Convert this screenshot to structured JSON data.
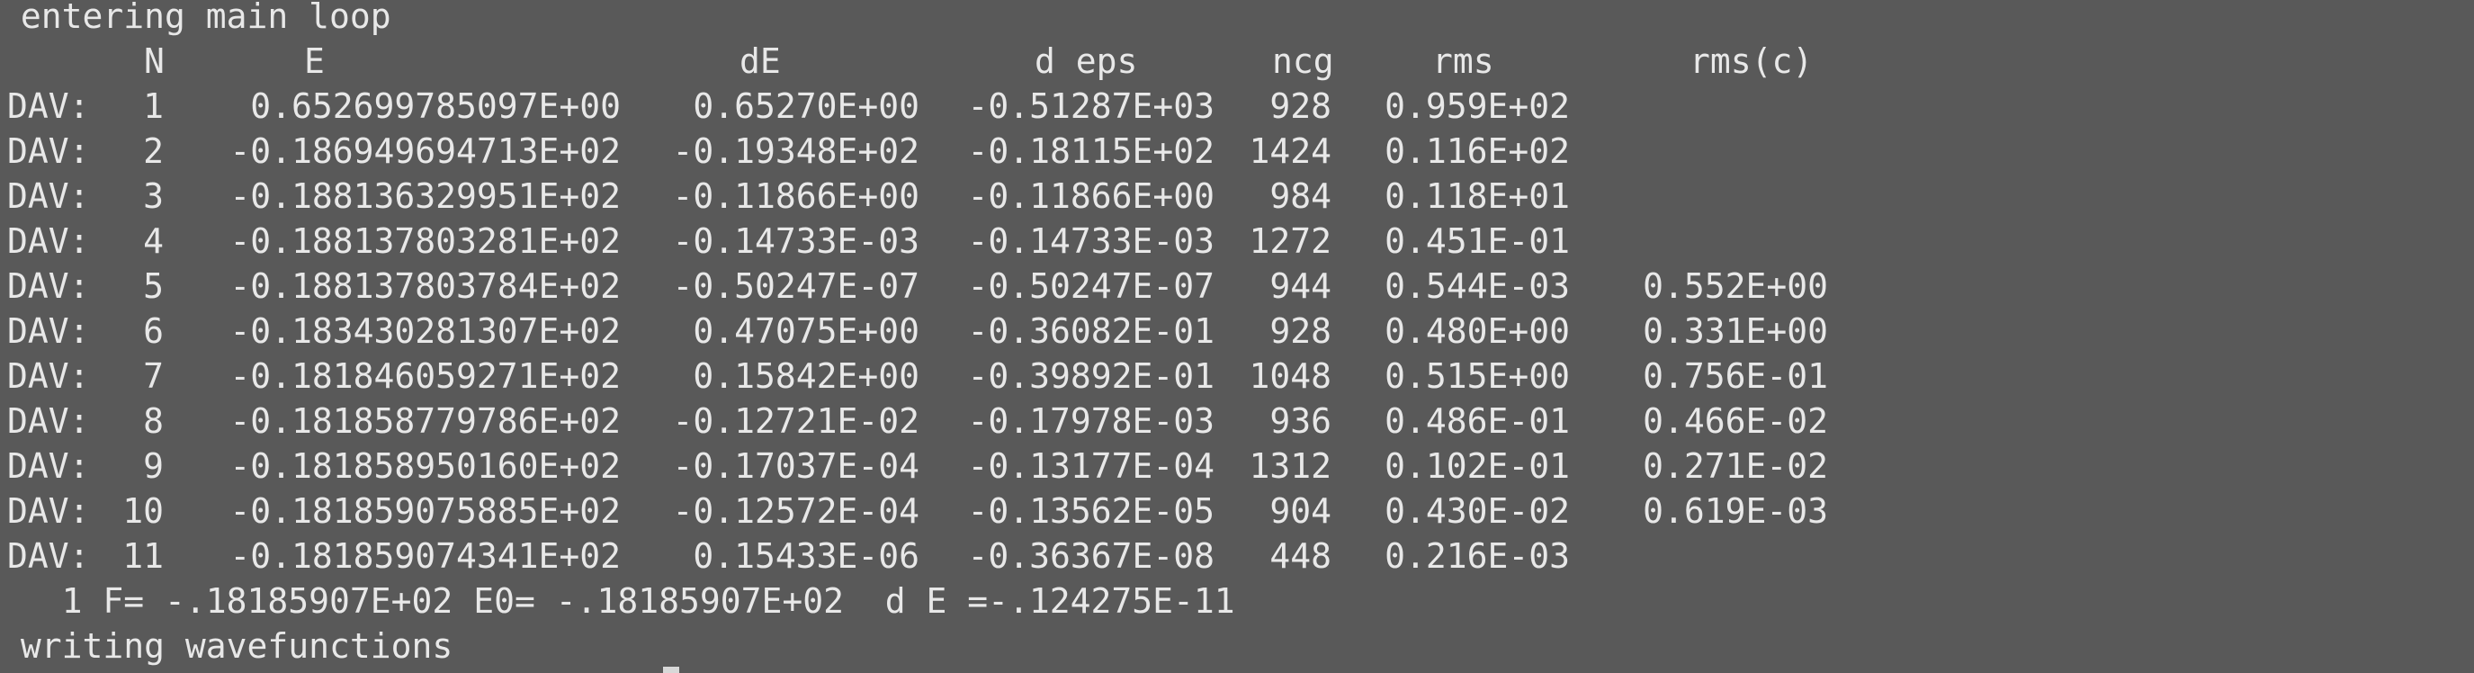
{
  "terminal": {
    "intro": " entering main loop",
    "headers": {
      "n": "N",
      "e": "E",
      "de": "dE",
      "deps": "d eps",
      "ncg": "ncg",
      "rms": "rms",
      "rmsc": "rms(c)"
    },
    "rows": [
      {
        "label": "DAV:",
        "n": "1",
        "e": "0.652699785097E+00",
        "de": "0.65270E+00",
        "deps": "-0.51287E+03",
        "ncg": "928",
        "rms": "0.959E+02",
        "rmsc": ""
      },
      {
        "label": "DAV:",
        "n": "2",
        "e": "-0.186949694713E+02",
        "de": "-0.19348E+02",
        "deps": "-0.18115E+02",
        "ncg": "1424",
        "rms": "0.116E+02",
        "rmsc": ""
      },
      {
        "label": "DAV:",
        "n": "3",
        "e": "-0.188136329951E+02",
        "de": "-0.11866E+00",
        "deps": "-0.11866E+00",
        "ncg": "984",
        "rms": "0.118E+01",
        "rmsc": ""
      },
      {
        "label": "DAV:",
        "n": "4",
        "e": "-0.188137803281E+02",
        "de": "-0.14733E-03",
        "deps": "-0.14733E-03",
        "ncg": "1272",
        "rms": "0.451E-01",
        "rmsc": ""
      },
      {
        "label": "DAV:",
        "n": "5",
        "e": "-0.188137803784E+02",
        "de": "-0.50247E-07",
        "deps": "-0.50247E-07",
        "ncg": "944",
        "rms": "0.544E-03",
        "rmsc": "0.552E+00"
      },
      {
        "label": "DAV:",
        "n": "6",
        "e": "-0.183430281307E+02",
        "de": "0.47075E+00",
        "deps": "-0.36082E-01",
        "ncg": "928",
        "rms": "0.480E+00",
        "rmsc": "0.331E+00"
      },
      {
        "label": "DAV:",
        "n": "7",
        "e": "-0.181846059271E+02",
        "de": "0.15842E+00",
        "deps": "-0.39892E-01",
        "ncg": "1048",
        "rms": "0.515E+00",
        "rmsc": "0.756E-01"
      },
      {
        "label": "DAV:",
        "n": "8",
        "e": "-0.181858779786E+02",
        "de": "-0.12721E-02",
        "deps": "-0.17978E-03",
        "ncg": "936",
        "rms": "0.486E-01",
        "rmsc": "0.466E-02"
      },
      {
        "label": "DAV:",
        "n": "9",
        "e": "-0.181858950160E+02",
        "de": "-0.17037E-04",
        "deps": "-0.13177E-04",
        "ncg": "1312",
        "rms": "0.102E-01",
        "rmsc": "0.271E-02"
      },
      {
        "label": "DAV:",
        "n": "10",
        "e": "-0.181859075885E+02",
        "de": "-0.12572E-04",
        "deps": "-0.13562E-05",
        "ncg": "904",
        "rms": "0.430E-02",
        "rmsc": "0.619E-03"
      },
      {
        "label": "DAV:",
        "n": "11",
        "e": "-0.181859074341E+02",
        "de": "0.15433E-06",
        "deps": "-0.36367E-08",
        "ncg": "448",
        "rms": "0.216E-03",
        "rmsc": ""
      }
    ],
    "summary": "   1 F= -.18185907E+02 E0= -.18185907E+02  d E =-.124275E-11",
    "status": " writing wavefunctions"
  },
  "colors": {
    "background": "#595959",
    "text": "#e8e8e8",
    "cursor": "#d8d8d8"
  }
}
